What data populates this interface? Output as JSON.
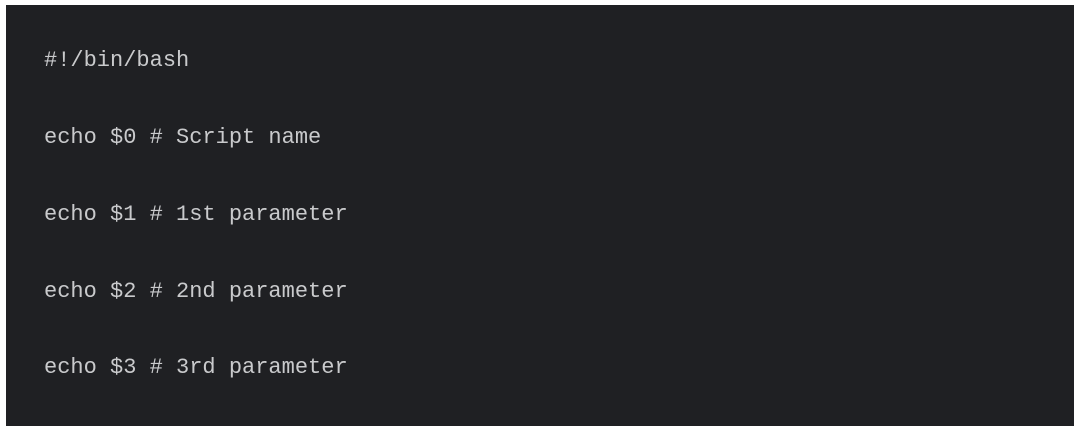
{
  "code_block": {
    "language": "bash",
    "background_color": "#1f2023",
    "text_color": "#c9cacc",
    "lines": [
      "#!/bin/bash",
      "echo $0 # Script name",
      "echo $1 # 1st parameter",
      "echo $2 # 2nd parameter",
      "echo $3 # 3rd parameter"
    ]
  }
}
